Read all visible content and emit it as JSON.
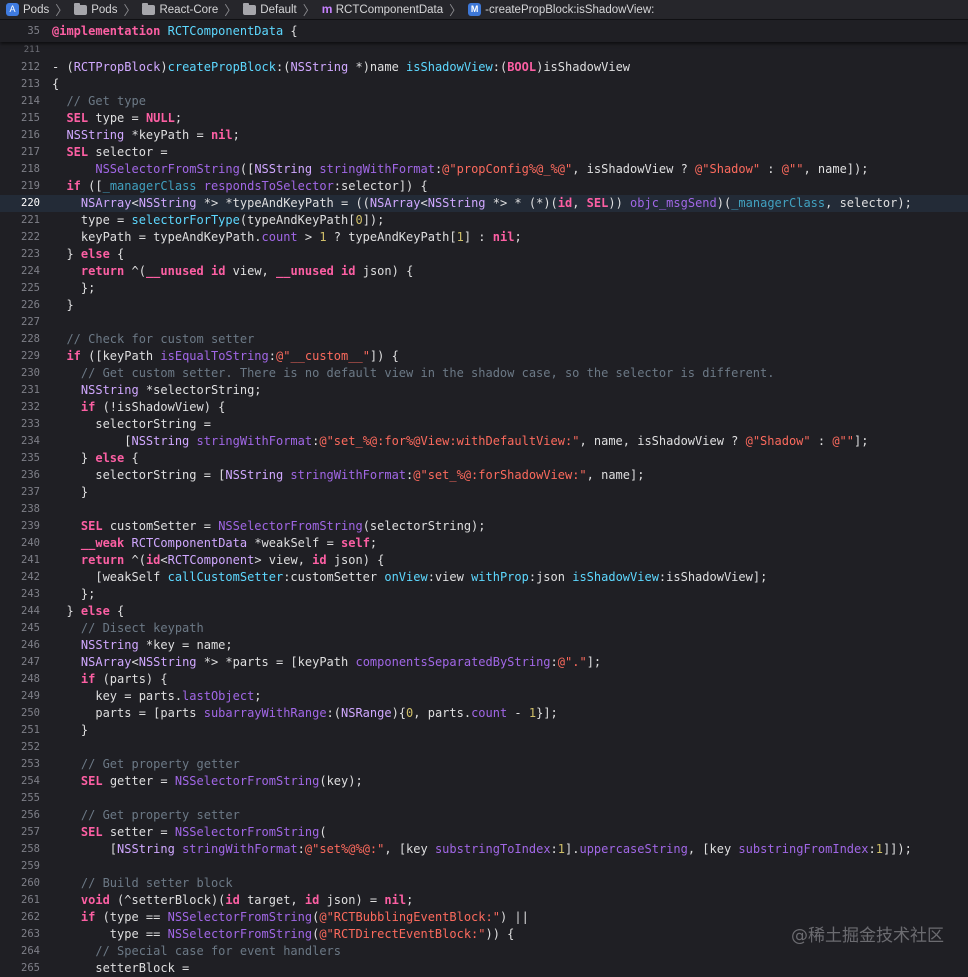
{
  "breadcrumbs": [
    {
      "label": "Pods",
      "icon": "project-icon"
    },
    {
      "label": "Pods",
      "icon": "folder-icon"
    },
    {
      "label": "React-Core",
      "icon": "folder-icon"
    },
    {
      "label": "Default",
      "icon": "folder-icon"
    },
    {
      "label": "RCTComponentData",
      "icon": "class-icon"
    },
    {
      "label": "-createPropBlock:isShadowView:",
      "icon": "method-icon"
    }
  ],
  "sticky_header": {
    "line_number": "35",
    "tokens": [
      {
        "t": "@implementation",
        "c": "kw"
      },
      {
        "t": " "
      },
      {
        "t": "RCTComponentData",
        "c": "tp"
      },
      {
        "t": " {"
      }
    ]
  },
  "watermark": "@稀土掘金技术社区",
  "current_line": 220,
  "lines": [
    {
      "n": "211",
      "small": true,
      "tokens": []
    },
    {
      "n": "212",
      "tokens": [
        {
          "t": "- ("
        },
        {
          "t": "RCTPropBlock",
          "c": "cls"
        },
        {
          "t": ")"
        },
        {
          "t": "createPropBlock",
          "c": "tp"
        },
        {
          "t": ":("
        },
        {
          "t": "NSString",
          "c": "cls"
        },
        {
          "t": " *)name "
        },
        {
          "t": "isShadowView",
          "c": "tp"
        },
        {
          "t": ":("
        },
        {
          "t": "BOOL",
          "c": "kw"
        },
        {
          "t": ")isShadowView"
        }
      ]
    },
    {
      "n": "213",
      "tokens": [
        {
          "t": "{"
        }
      ]
    },
    {
      "n": "214",
      "tokens": [
        {
          "t": "  "
        },
        {
          "t": "// Get type",
          "c": "cm"
        }
      ]
    },
    {
      "n": "215",
      "tokens": [
        {
          "t": "  "
        },
        {
          "t": "SEL",
          "c": "kw"
        },
        {
          "t": " type = "
        },
        {
          "t": "NULL",
          "c": "kw"
        },
        {
          "t": ";"
        }
      ]
    },
    {
      "n": "216",
      "tokens": [
        {
          "t": "  "
        },
        {
          "t": "NSString",
          "c": "cls"
        },
        {
          "t": " *keyPath = "
        },
        {
          "t": "nil",
          "c": "kw"
        },
        {
          "t": ";"
        }
      ]
    },
    {
      "n": "217",
      "tokens": [
        {
          "t": "  "
        },
        {
          "t": "SEL",
          "c": "kw"
        },
        {
          "t": " selector ="
        }
      ]
    },
    {
      "n": "218",
      "tokens": [
        {
          "t": "      "
        },
        {
          "t": "NSSelectorFromString",
          "c": "fn"
        },
        {
          "t": "(["
        },
        {
          "t": "NSString",
          "c": "cls"
        },
        {
          "t": " "
        },
        {
          "t": "stringWithFormat",
          "c": "fn"
        },
        {
          "t": ":"
        },
        {
          "t": "@\"propConfig%@_%@\"",
          "c": "str"
        },
        {
          "t": ", isShadowView ? "
        },
        {
          "t": "@\"Shadow\"",
          "c": "str"
        },
        {
          "t": " : "
        },
        {
          "t": "@\"\"",
          "c": "str"
        },
        {
          "t": ", name]);"
        }
      ]
    },
    {
      "n": "219",
      "tokens": [
        {
          "t": "  "
        },
        {
          "t": "if",
          "c": "kw"
        },
        {
          "t": " (["
        },
        {
          "t": "_managerClass",
          "c": "var"
        },
        {
          "t": " "
        },
        {
          "t": "respondsToSelector",
          "c": "fn"
        },
        {
          "t": ":selector]) {"
        }
      ]
    },
    {
      "n": "220",
      "tokens": [
        {
          "t": "    "
        },
        {
          "t": "NSArray",
          "c": "cls"
        },
        {
          "t": "<"
        },
        {
          "t": "NSString",
          "c": "cls"
        },
        {
          "t": " *> *typeAndKeyPath = (("
        },
        {
          "t": "NSArray",
          "c": "cls"
        },
        {
          "t": "<"
        },
        {
          "t": "NSString",
          "c": "cls"
        },
        {
          "t": " *> * (*)("
        },
        {
          "t": "id",
          "c": "kw"
        },
        {
          "t": ", "
        },
        {
          "t": "SEL",
          "c": "kw"
        },
        {
          "t": ")) "
        },
        {
          "t": "objc_msgSend",
          "c": "fn"
        },
        {
          "t": ")("
        },
        {
          "t": "_managerClass",
          "c": "var"
        },
        {
          "t": ", selector);"
        }
      ]
    },
    {
      "n": "221",
      "tokens": [
        {
          "t": "    type = "
        },
        {
          "t": "selectorForType",
          "c": "tp"
        },
        {
          "t": "(typeAndKeyPath["
        },
        {
          "t": "0",
          "c": "num"
        },
        {
          "t": "]);"
        }
      ]
    },
    {
      "n": "222",
      "tokens": [
        {
          "t": "    keyPath = typeAndKeyPath."
        },
        {
          "t": "count",
          "c": "prop"
        },
        {
          "t": " > "
        },
        {
          "t": "1",
          "c": "num"
        },
        {
          "t": " ? typeAndKeyPath["
        },
        {
          "t": "1",
          "c": "num"
        },
        {
          "t": "] : "
        },
        {
          "t": "nil",
          "c": "kw"
        },
        {
          "t": ";"
        }
      ]
    },
    {
      "n": "223",
      "tokens": [
        {
          "t": "  } "
        },
        {
          "t": "else",
          "c": "kw"
        },
        {
          "t": " {"
        }
      ]
    },
    {
      "n": "224",
      "tokens": [
        {
          "t": "    "
        },
        {
          "t": "return",
          "c": "kw"
        },
        {
          "t": " ^("
        },
        {
          "t": "__unused",
          "c": "kw"
        },
        {
          "t": " "
        },
        {
          "t": "id",
          "c": "kw"
        },
        {
          "t": " view, "
        },
        {
          "t": "__unused",
          "c": "kw"
        },
        {
          "t": " "
        },
        {
          "t": "id",
          "c": "kw"
        },
        {
          "t": " json) {"
        }
      ]
    },
    {
      "n": "225",
      "tokens": [
        {
          "t": "    };"
        }
      ]
    },
    {
      "n": "226",
      "tokens": [
        {
          "t": "  }"
        }
      ]
    },
    {
      "n": "227",
      "tokens": []
    },
    {
      "n": "228",
      "tokens": [
        {
          "t": "  "
        },
        {
          "t": "// Check for custom setter",
          "c": "cm"
        }
      ]
    },
    {
      "n": "229",
      "tokens": [
        {
          "t": "  "
        },
        {
          "t": "if",
          "c": "kw"
        },
        {
          "t": " ([keyPath "
        },
        {
          "t": "isEqualToString",
          "c": "fn"
        },
        {
          "t": ":"
        },
        {
          "t": "@\"__custom__\"",
          "c": "str"
        },
        {
          "t": "]) {"
        }
      ]
    },
    {
      "n": "230",
      "tokens": [
        {
          "t": "    "
        },
        {
          "t": "// Get custom setter. There is no default view in the shadow case, so the selector is different.",
          "c": "cm"
        }
      ]
    },
    {
      "n": "231",
      "tokens": [
        {
          "t": "    "
        },
        {
          "t": "NSString",
          "c": "cls"
        },
        {
          "t": " *selectorString;"
        }
      ]
    },
    {
      "n": "232",
      "tokens": [
        {
          "t": "    "
        },
        {
          "t": "if",
          "c": "kw"
        },
        {
          "t": " (!isShadowView) {"
        }
      ]
    },
    {
      "n": "233",
      "tokens": [
        {
          "t": "      selectorString ="
        }
      ]
    },
    {
      "n": "234",
      "tokens": [
        {
          "t": "          ["
        },
        {
          "t": "NSString",
          "c": "cls"
        },
        {
          "t": " "
        },
        {
          "t": "stringWithFormat",
          "c": "fn"
        },
        {
          "t": ":"
        },
        {
          "t": "@\"set_%@:for%@View:withDefaultView:\"",
          "c": "str"
        },
        {
          "t": ", name, isShadowView ? "
        },
        {
          "t": "@\"Shadow\"",
          "c": "str"
        },
        {
          "t": " : "
        },
        {
          "t": "@\"\"",
          "c": "str"
        },
        {
          "t": "];"
        }
      ]
    },
    {
      "n": "235",
      "tokens": [
        {
          "t": "    } "
        },
        {
          "t": "else",
          "c": "kw"
        },
        {
          "t": " {"
        }
      ]
    },
    {
      "n": "236",
      "tokens": [
        {
          "t": "      selectorString = ["
        },
        {
          "t": "NSString",
          "c": "cls"
        },
        {
          "t": " "
        },
        {
          "t": "stringWithFormat",
          "c": "fn"
        },
        {
          "t": ":"
        },
        {
          "t": "@\"set_%@:forShadowView:\"",
          "c": "str"
        },
        {
          "t": ", name];"
        }
      ]
    },
    {
      "n": "237",
      "tokens": [
        {
          "t": "    }"
        }
      ]
    },
    {
      "n": "238",
      "tokens": []
    },
    {
      "n": "239",
      "tokens": [
        {
          "t": "    "
        },
        {
          "t": "SEL",
          "c": "kw"
        },
        {
          "t": " customSetter = "
        },
        {
          "t": "NSSelectorFromString",
          "c": "fn"
        },
        {
          "t": "(selectorString);"
        }
      ]
    },
    {
      "n": "240",
      "tokens": [
        {
          "t": "    "
        },
        {
          "t": "__weak",
          "c": "kw"
        },
        {
          "t": " "
        },
        {
          "t": "RCTComponentData",
          "c": "cls"
        },
        {
          "t": " *weakSelf = "
        },
        {
          "t": "self",
          "c": "kw"
        },
        {
          "t": ";"
        }
      ]
    },
    {
      "n": "241",
      "tokens": [
        {
          "t": "    "
        },
        {
          "t": "return",
          "c": "kw"
        },
        {
          "t": " ^("
        },
        {
          "t": "id",
          "c": "kw"
        },
        {
          "t": "<"
        },
        {
          "t": "RCTComponent",
          "c": "cls"
        },
        {
          "t": "> view, "
        },
        {
          "t": "id",
          "c": "kw"
        },
        {
          "t": " json) {"
        }
      ]
    },
    {
      "n": "242",
      "tokens": [
        {
          "t": "      [weakSelf "
        },
        {
          "t": "callCustomSetter",
          "c": "tp"
        },
        {
          "t": ":customSetter "
        },
        {
          "t": "onView",
          "c": "tp"
        },
        {
          "t": ":view "
        },
        {
          "t": "withProp",
          "c": "tp"
        },
        {
          "t": ":json "
        },
        {
          "t": "isShadowView",
          "c": "tp"
        },
        {
          "t": ":isShadowView];"
        }
      ]
    },
    {
      "n": "243",
      "tokens": [
        {
          "t": "    };"
        }
      ]
    },
    {
      "n": "244",
      "tokens": [
        {
          "t": "  } "
        },
        {
          "t": "else",
          "c": "kw"
        },
        {
          "t": " {"
        }
      ]
    },
    {
      "n": "245",
      "tokens": [
        {
          "t": "    "
        },
        {
          "t": "// Disect keypath",
          "c": "cm"
        }
      ]
    },
    {
      "n": "246",
      "tokens": [
        {
          "t": "    "
        },
        {
          "t": "NSString",
          "c": "cls"
        },
        {
          "t": " *key = name;"
        }
      ]
    },
    {
      "n": "247",
      "tokens": [
        {
          "t": "    "
        },
        {
          "t": "NSArray",
          "c": "cls"
        },
        {
          "t": "<"
        },
        {
          "t": "NSString",
          "c": "cls"
        },
        {
          "t": " *> *parts = [keyPath "
        },
        {
          "t": "componentsSeparatedByString",
          "c": "fn"
        },
        {
          "t": ":"
        },
        {
          "t": "@\".\"",
          "c": "str"
        },
        {
          "t": "];"
        }
      ]
    },
    {
      "n": "248",
      "tokens": [
        {
          "t": "    "
        },
        {
          "t": "if",
          "c": "kw"
        },
        {
          "t": " (parts) {"
        }
      ]
    },
    {
      "n": "249",
      "tokens": [
        {
          "t": "      key = parts."
        },
        {
          "t": "lastObject",
          "c": "prop"
        },
        {
          "t": ";"
        }
      ]
    },
    {
      "n": "250",
      "tokens": [
        {
          "t": "      parts = [parts "
        },
        {
          "t": "subarrayWithRange",
          "c": "fn"
        },
        {
          "t": ":("
        },
        {
          "t": "NSRange",
          "c": "cls"
        },
        {
          "t": "){"
        },
        {
          "t": "0",
          "c": "num"
        },
        {
          "t": ", parts."
        },
        {
          "t": "count",
          "c": "prop"
        },
        {
          "t": " - "
        },
        {
          "t": "1",
          "c": "num"
        },
        {
          "t": "}];"
        }
      ]
    },
    {
      "n": "251",
      "tokens": [
        {
          "t": "    }"
        }
      ]
    },
    {
      "n": "252",
      "tokens": []
    },
    {
      "n": "253",
      "tokens": [
        {
          "t": "    "
        },
        {
          "t": "// Get property getter",
          "c": "cm"
        }
      ]
    },
    {
      "n": "254",
      "tokens": [
        {
          "t": "    "
        },
        {
          "t": "SEL",
          "c": "kw"
        },
        {
          "t": " getter = "
        },
        {
          "t": "NSSelectorFromString",
          "c": "fn"
        },
        {
          "t": "(key);"
        }
      ]
    },
    {
      "n": "255",
      "tokens": []
    },
    {
      "n": "256",
      "tokens": [
        {
          "t": "    "
        },
        {
          "t": "// Get property setter",
          "c": "cm"
        }
      ]
    },
    {
      "n": "257",
      "tokens": [
        {
          "t": "    "
        },
        {
          "t": "SEL",
          "c": "kw"
        },
        {
          "t": " setter = "
        },
        {
          "t": "NSSelectorFromString",
          "c": "fn"
        },
        {
          "t": "("
        }
      ]
    },
    {
      "n": "258",
      "tokens": [
        {
          "t": "        ["
        },
        {
          "t": "NSString",
          "c": "cls"
        },
        {
          "t": " "
        },
        {
          "t": "stringWithFormat",
          "c": "fn"
        },
        {
          "t": ":"
        },
        {
          "t": "@\"set%@%@:\"",
          "c": "str"
        },
        {
          "t": ", [key "
        },
        {
          "t": "substringToIndex",
          "c": "fn"
        },
        {
          "t": ":"
        },
        {
          "t": "1",
          "c": "num"
        },
        {
          "t": "]."
        },
        {
          "t": "uppercaseString",
          "c": "prop"
        },
        {
          "t": ", [key "
        },
        {
          "t": "substringFromIndex",
          "c": "fn"
        },
        {
          "t": ":"
        },
        {
          "t": "1",
          "c": "num"
        },
        {
          "t": "]]);"
        }
      ]
    },
    {
      "n": "259",
      "tokens": []
    },
    {
      "n": "260",
      "tokens": [
        {
          "t": "    "
        },
        {
          "t": "// Build setter block",
          "c": "cm"
        }
      ]
    },
    {
      "n": "261",
      "tokens": [
        {
          "t": "    "
        },
        {
          "t": "void",
          "c": "kw"
        },
        {
          "t": " (^setterBlock)("
        },
        {
          "t": "id",
          "c": "kw"
        },
        {
          "t": " target, "
        },
        {
          "t": "id",
          "c": "kw"
        },
        {
          "t": " json) = "
        },
        {
          "t": "nil",
          "c": "kw"
        },
        {
          "t": ";"
        }
      ]
    },
    {
      "n": "262",
      "tokens": [
        {
          "t": "    "
        },
        {
          "t": "if",
          "c": "kw"
        },
        {
          "t": " (type == "
        },
        {
          "t": "NSSelectorFromString",
          "c": "fn"
        },
        {
          "t": "("
        },
        {
          "t": "@\"RCTBubblingEventBlock:\"",
          "c": "str"
        },
        {
          "t": ") ||"
        }
      ]
    },
    {
      "n": "263",
      "tokens": [
        {
          "t": "        type == "
        },
        {
          "t": "NSSelectorFromString",
          "c": "fn"
        },
        {
          "t": "("
        },
        {
          "t": "@\"RCTDirectEventBlock:\"",
          "c": "str"
        },
        {
          "t": ")) {"
        }
      ]
    },
    {
      "n": "264",
      "tokens": [
        {
          "t": "      "
        },
        {
          "t": "// Special case for event handlers",
          "c": "cm"
        }
      ]
    },
    {
      "n": "265",
      "tokens": [
        {
          "t": "      setterBlock ="
        }
      ]
    }
  ]
}
